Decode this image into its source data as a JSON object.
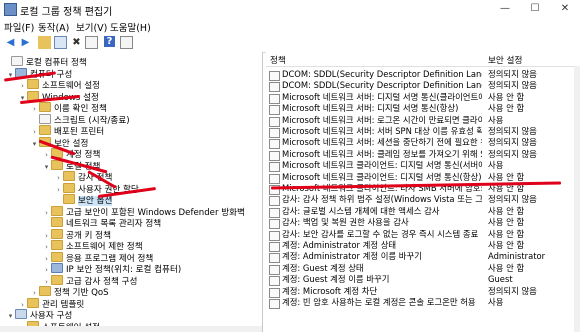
{
  "window": {
    "title": "로컬 그룹 정책 편집기",
    "min": "—",
    "max": "☐",
    "close": "✕"
  },
  "menu": [
    "파일(F)",
    "동작(A)",
    "보기(V)",
    "도움말(H)"
  ],
  "tree": [
    {
      "label": "로컬 컴퓨터 정책",
      "toggle": "",
      "icon": "doc"
    },
    {
      "label": "컴퓨터 구성",
      "toggle": "▾",
      "icon": "pc"
    },
    {
      "label": "소프트웨어 설정",
      "toggle": "›",
      "icon": "folder"
    },
    {
      "label": "Windows 설정",
      "toggle": "▾",
      "icon": "folder"
    },
    {
      "label": "이름 확인 정책",
      "toggle": "›",
      "icon": "folder"
    },
    {
      "label": "스크립트 (시작/종료)",
      "toggle": "",
      "icon": "doc"
    },
    {
      "label": "배포된 프린터",
      "toggle": "›",
      "icon": "folder"
    },
    {
      "label": "보안 설정",
      "toggle": "▾",
      "icon": "folder"
    },
    {
      "label": "계정 정책",
      "toggle": "›",
      "icon": "folder"
    },
    {
      "label": "로컬 정책",
      "toggle": "▾",
      "icon": "folder"
    },
    {
      "label": "감사 정책",
      "toggle": "›",
      "icon": "folder"
    },
    {
      "label": "사용자 권한 할당",
      "toggle": "›",
      "icon": "folder"
    },
    {
      "label": "보안 옵션",
      "toggle": "",
      "icon": "folder",
      "selected": true
    },
    {
      "label": "고급 보안이 포함된 Windows Defender 방화벽",
      "toggle": "›",
      "icon": "folder"
    },
    {
      "label": "네트워크 목록 관리자 정책",
      "toggle": "",
      "icon": "folder"
    },
    {
      "label": "공개 키 정책",
      "toggle": "›",
      "icon": "folder"
    },
    {
      "label": "소프트웨어 제한 정책",
      "toggle": "›",
      "icon": "folder"
    },
    {
      "label": "응용 프로그램 제어 정책",
      "toggle": "›",
      "icon": "folder"
    },
    {
      "label": "IP 보안 정책(위치: 로컬 컴퓨터)",
      "toggle": "›",
      "icon": "pc"
    },
    {
      "label": "고급 감사 정책 구성",
      "toggle": "›",
      "icon": "folder"
    },
    {
      "label": "정책 기반 QoS",
      "toggle": "›",
      "icon": "folder"
    },
    {
      "label": "관리 템플릿",
      "toggle": "›",
      "icon": "folder"
    },
    {
      "label": "사용자 구성",
      "toggle": "▾",
      "icon": "user"
    },
    {
      "label": "소프트웨어 설정",
      "toggle": "›",
      "icon": "folder"
    }
  ],
  "columns": {
    "policy": "정책",
    "setting": "보안 설정"
  },
  "rows": [
    {
      "policy": "DCOM: SDDL(Security Descriptor Definition Language) 구...",
      "setting": "정의되지 않음"
    },
    {
      "policy": "DCOM: SDDL(Security Descriptor Definition Language) 구...",
      "setting": "정의되지 않음"
    },
    {
      "policy": "Microsoft 네트워크 서버: 디지털 서명 통신(클라이언트에...",
      "setting": "사용 안 함"
    },
    {
      "policy": "Microsoft 네트워크 서버: 디지털 서명 통신(항상)",
      "setting": "사용 안 함"
    },
    {
      "policy": "Microsoft 네트워크 서버: 로그온 시간이 만료되면 클라이...",
      "setting": "사용"
    },
    {
      "policy": "Microsoft 네트워크 서버: 서버 SPN 대상 이름 유효성 확인 ...",
      "setting": "정의되지 않음"
    },
    {
      "policy": "Microsoft 네트워크 서버: 세션을 중단하기 전에 필요한 유...",
      "setting": "정의되지 않음"
    },
    {
      "policy": "Microsoft 네트워크 서버: 클레임 정보를 가져오기 위해 S4...",
      "setting": "정의되지 않음"
    },
    {
      "policy": "Microsoft 네트워크 클라이언트: 디지털 서명 통신(서버에...",
      "setting": "사용"
    },
    {
      "policy": "Microsoft 네트워크 클라이언트: 디지털 서명 통신(항상)",
      "setting": "사용 안 함"
    },
    {
      "policy": "Microsoft 네트워크 클라이언트: 타사 SMB 서버에 암호화...",
      "setting": "사용 안 함"
    },
    {
      "policy": "감사: 감사 정책 하위 범주 설정(Windows Vista 또는 그 이...",
      "setting": "정의되지 않음"
    },
    {
      "policy": "감사: 글로벌 시스템 개체에 대한 액세스 감사",
      "setting": "사용 안 함"
    },
    {
      "policy": "감사: 백업 및 복원 권한 사용을 감사",
      "setting": "사용 안 함"
    },
    {
      "policy": "감사: 보안 감사를 로그할 수 없는 경우 즉시 시스템 종료",
      "setting": "사용 안 함"
    },
    {
      "policy": "계정: Administrator 계정 상태",
      "setting": "사용 안 함"
    },
    {
      "policy": "계정: Administrator 계정 이름 바꾸기",
      "setting": "Administrator"
    },
    {
      "policy": "계정: Guest 계정 상태",
      "setting": "사용 안 함"
    },
    {
      "policy": "계정: Guest 계정 이름 바꾸기",
      "setting": "Guest"
    },
    {
      "policy": "계정: Microsoft 계정 차단",
      "setting": "정의되지 않음"
    },
    {
      "policy": "계정: 빈 암호 사용하는 로컬 계정은 콘솔 로그온만 허용",
      "setting": "사용"
    }
  ],
  "colors": {
    "annotation": "#e0001a",
    "selection": "#cce4f7"
  }
}
